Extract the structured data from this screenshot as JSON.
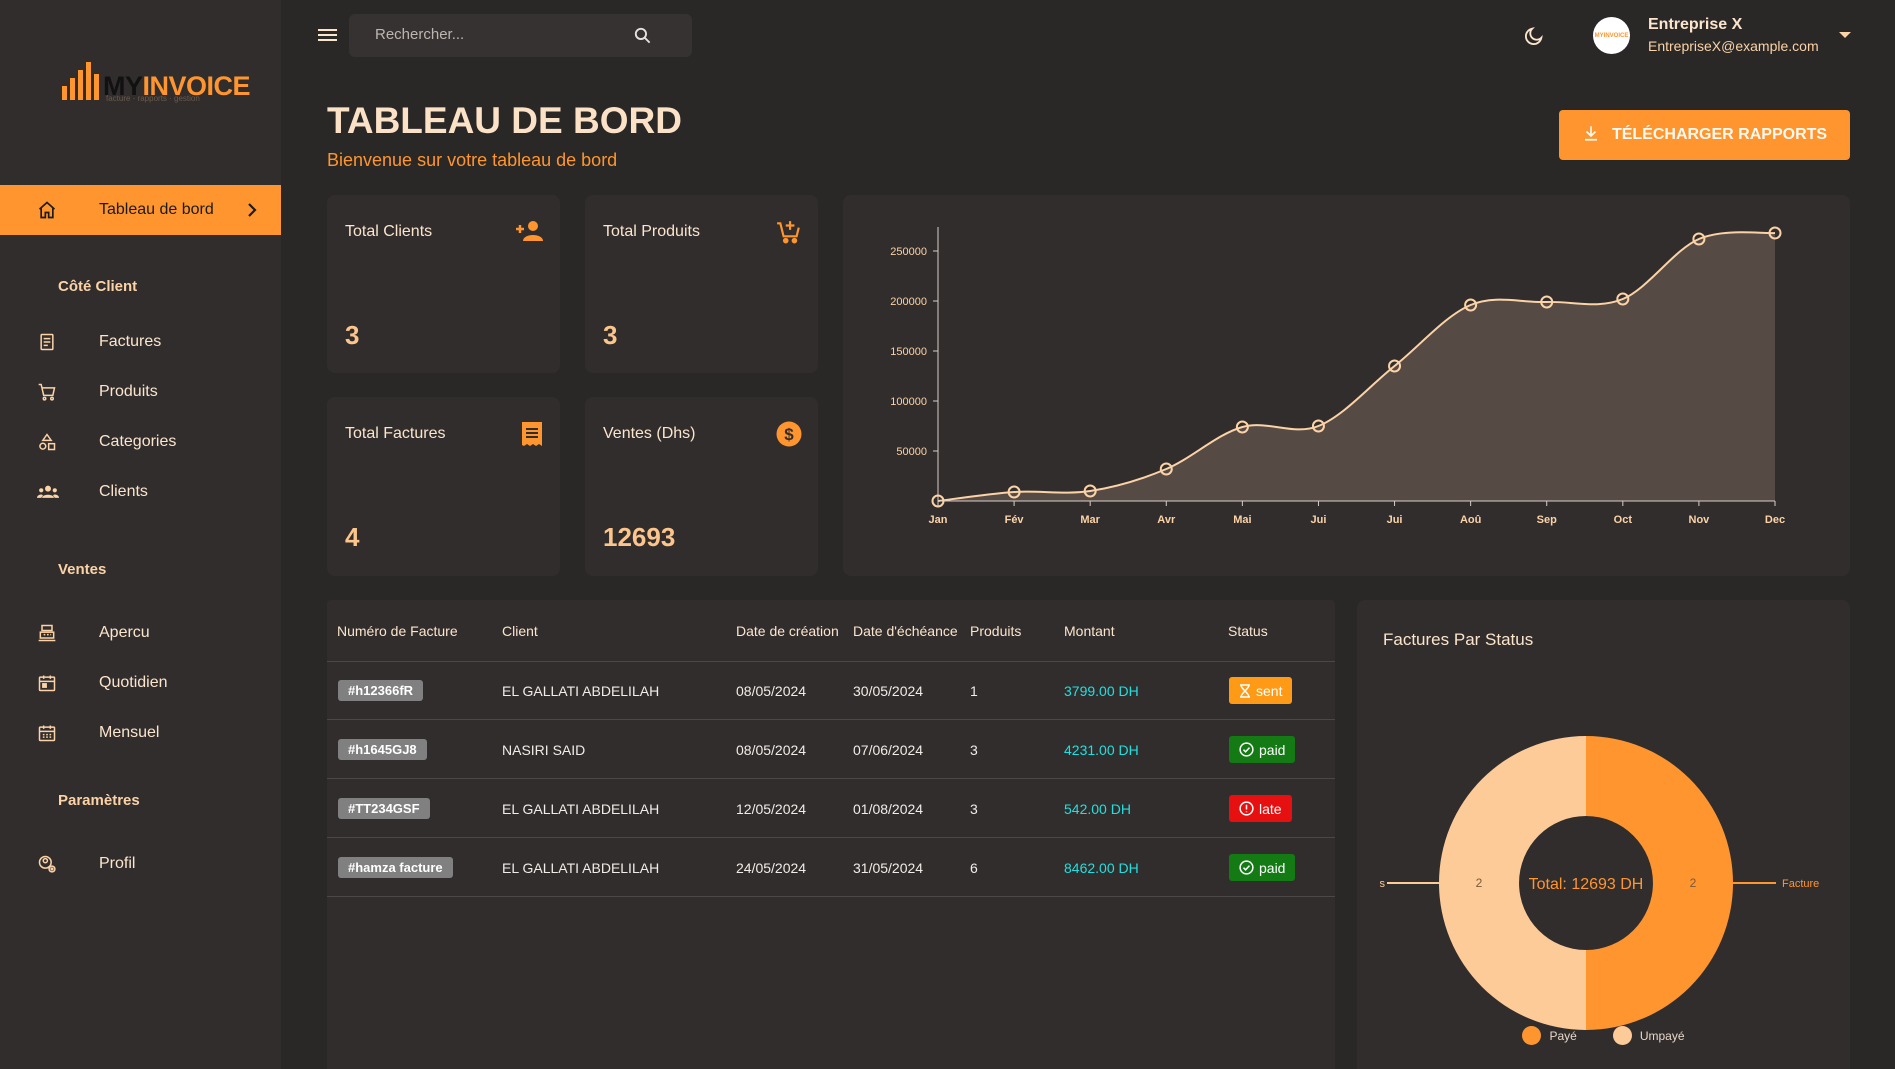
{
  "app": {
    "logo_my": "MY",
    "logo_invoice": "INVOICE",
    "logo_tagline": "facture · rapports · gestion"
  },
  "colors": {
    "accent": "#ff952e",
    "cream": "#fbd3a7",
    "card": "#312d2d",
    "background": "#2a2727"
  },
  "sidebar": {
    "active_item": {
      "label": "Tableau de bord",
      "icon": "home-icon"
    },
    "sections": [
      {
        "title": "Côté Client",
        "items": [
          {
            "label": "Factures",
            "icon": "invoice-icon"
          },
          {
            "label": "Produits",
            "icon": "cart-icon"
          },
          {
            "label": "Categories",
            "icon": "categories-icon"
          },
          {
            "label": "Clients",
            "icon": "users-icon"
          }
        ]
      },
      {
        "title": "Ventes",
        "items": [
          {
            "label": "Apercu",
            "icon": "register-icon"
          },
          {
            "label": "Quotidien",
            "icon": "calendar-day-icon"
          },
          {
            "label": "Mensuel",
            "icon": "calendar-month-icon"
          }
        ]
      },
      {
        "title": "Paramètres",
        "items": [
          {
            "label": "Profil",
            "icon": "profile-settings-icon"
          }
        ]
      }
    ]
  },
  "topbar": {
    "search_placeholder": "Rechercher...",
    "user_name": "Entreprise X",
    "user_email": "EntrepriseX@example.com",
    "avatar_text": "MYINVOICE"
  },
  "header": {
    "title": "TABLEAU DE BORD",
    "subtitle": "Bienvenue sur votre tableau de bord",
    "download_label": "TÉLÉCHARGER RAPPORTS"
  },
  "stats": [
    {
      "title": "Total Clients",
      "value": "3",
      "icon": "add-user-icon"
    },
    {
      "title": "Total Produits",
      "value": "3",
      "icon": "add-cart-icon"
    },
    {
      "title": "Total Factures",
      "value": "4",
      "icon": "receipt-icon"
    },
    {
      "title": "Ventes (Dhs)",
      "value": "12693",
      "icon": "dollar-circle-icon"
    }
  ],
  "table": {
    "headers": [
      "Numéro de Facture",
      "Client",
      "Date de création",
      "Date d'échéance",
      "Produits",
      "Montant",
      "Status"
    ],
    "rows": [
      {
        "id": "#h12366fR",
        "client": "EL GALLATI ABDELILAH",
        "created": "08/05/2024",
        "due": "30/05/2024",
        "products": "1",
        "amount": "3799.00 DH",
        "status": "sent"
      },
      {
        "id": "#h1645GJ8",
        "client": "NASIRI SAID",
        "created": "08/05/2024",
        "due": "07/06/2024",
        "products": "3",
        "amount": "4231.00 DH",
        "status": "paid"
      },
      {
        "id": "#TT234GSF",
        "client": "EL GALLATI ABDELILAH",
        "created": "12/05/2024",
        "due": "01/08/2024",
        "products": "3",
        "amount": "542.00 DH",
        "status": "late"
      },
      {
        "id": "#hamza facture",
        "client": "EL GALLATI ABDELILAH",
        "created": "24/05/2024",
        "due": "31/05/2024",
        "products": "6",
        "amount": "8462.00 DH",
        "status": "paid"
      }
    ]
  },
  "chart_data": [
    {
      "type": "area",
      "categories": [
        "Jan",
        "Fév",
        "Mar",
        "Avr",
        "Mai",
        "Jui",
        "Jui",
        "Aoû",
        "Sep",
        "Oct",
        "Nov",
        "Dec"
      ],
      "series": [
        {
          "values": [
            0,
            9000,
            10000,
            32000,
            74000,
            75000,
            135000,
            196000,
            199000,
            202000,
            262000,
            268000
          ]
        }
      ],
      "ylim": [
        0,
        268000
      ],
      "yticks": [
        50000,
        100000,
        150000,
        200000,
        250000
      ],
      "color": "#fbd3a7",
      "grid": false
    },
    {
      "type": "pie",
      "variant": "donut",
      "title": "Factures Par Status",
      "center_label": "Total: 12693 DH",
      "labels": [
        "Payé",
        "Umpayé"
      ],
      "values": [
        2,
        2
      ],
      "colors": [
        "#ff952e",
        "#fdcb97"
      ],
      "outer_left_label": "s",
      "outer_right_label": "Facture",
      "legend": "bottom"
    }
  ]
}
